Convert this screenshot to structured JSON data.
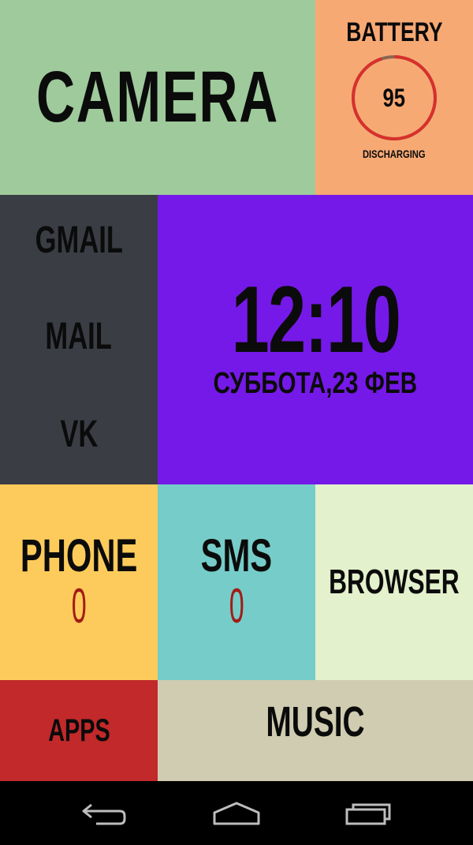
{
  "tiles": {
    "camera": {
      "label": "CAMERA",
      "color": "#9fca9b"
    },
    "battery": {
      "title": "BATTERY",
      "level": "95",
      "level_fraction": 0.95,
      "status": "DISCHARGING",
      "ring_color": "#d6312c",
      "color": "#f7a974"
    },
    "links": {
      "items": [
        {
          "label": "GMAIL"
        },
        {
          "label": "MAIL"
        },
        {
          "label": "VK"
        }
      ],
      "color": "#3a3d44"
    },
    "clock": {
      "time": "12:10",
      "date": "СУББОТА,23 ФЕВ",
      "color": "#7519e8"
    },
    "phone": {
      "label": "PHONE",
      "count": "0",
      "color": "#fdcb5b"
    },
    "sms": {
      "label": "SMS",
      "count": "0",
      "color": "#76ccc8"
    },
    "browser": {
      "label": "BROWSER",
      "color": "#e3f1cc"
    },
    "apps": {
      "label": "APPS",
      "color": "#c1292a"
    },
    "music": {
      "label": "MUSIC",
      "color": "#cfccb1"
    }
  },
  "navbar": {
    "buttons": [
      {
        "icon": "back-icon"
      },
      {
        "icon": "home-icon"
      },
      {
        "icon": "recent-apps-icon"
      }
    ]
  }
}
